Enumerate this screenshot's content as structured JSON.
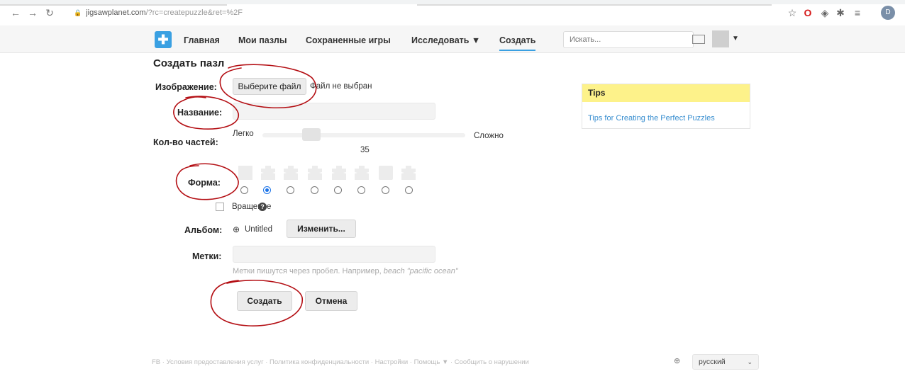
{
  "browser": {
    "url_host": "jigsawplanet.com",
    "url_path": "/?rc=createpuzzle&ret=%2F",
    "profile_initial": "D"
  },
  "nav": {
    "items": [
      "Главная",
      "Мои пазлы",
      "Сохраненные игры",
      "Исследовать ▼",
      "Создать"
    ],
    "search_placeholder": "Искать..."
  },
  "form": {
    "title": "Создать пазл",
    "image_label": "Изображение:",
    "choose_file": "Выберите файл",
    "no_file": "Файл не выбран",
    "name_label": "Название:",
    "pieces_label": "Кол-во частей:",
    "easy": "Легко",
    "hard": "Сложно",
    "pieces_value": "35",
    "shape_label": "Форма:",
    "selected_shape": 2,
    "rotation_label": "Вращение",
    "album_label": "Альбом:",
    "album_value": "Untitled",
    "change_button": "Изменить...",
    "tags_label": "Метки:",
    "tags_hint": "Метки пишутся через пробел. Например,",
    "tags_example": "beach \"pacific ocean\"",
    "create_button": "Создать",
    "cancel_button": "Отмена"
  },
  "tips": {
    "title": "Tips",
    "link": "Tips for Creating the Perfect Puzzles"
  },
  "footer": {
    "links": "FB · Условия предоставления услуг · Политика конфиденциальности · Настройки · Помощь ▼ · Сообщить о нарушении",
    "language": "русский"
  },
  "colors": {
    "accent": "#3aa0e2",
    "tips_header": "#fdf28a",
    "annotation": "#b40f14"
  }
}
